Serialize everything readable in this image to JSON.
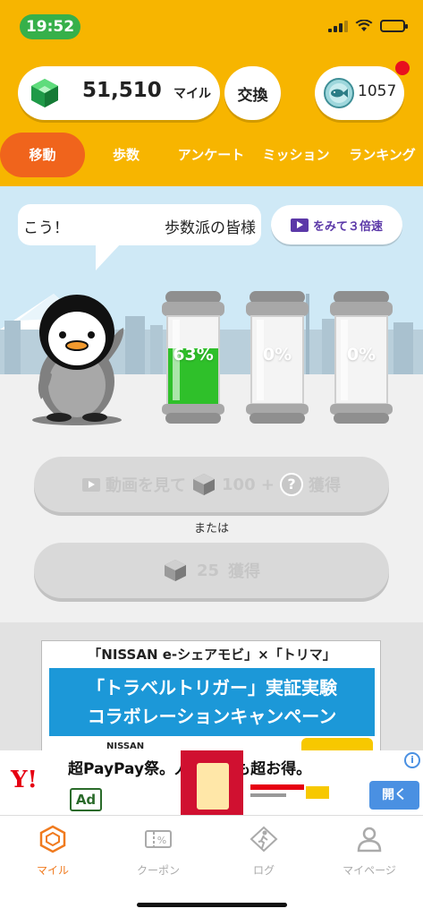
{
  "status_bar": {
    "time": "19:52"
  },
  "header": {
    "miles_value": "51,510",
    "miles_unit": "マイル",
    "exchange_label": "交換",
    "fish_count": "1057"
  },
  "tabs": [
    "移動",
    "歩数",
    "アンケート",
    "ミッション",
    "ランキング"
  ],
  "active_tab": "移動",
  "stage": {
    "bubble_text_left": "こう！",
    "bubble_text_right": "歩数派の皆様",
    "speed_button_label": "をみて３倍速",
    "capsules": [
      {
        "label": "63%",
        "fill": 0.63
      },
      {
        "label": "0%",
        "fill": 0
      },
      {
        "label": "0%",
        "fill": 0
      }
    ],
    "watch_video_label": "動画を見て",
    "watch_video_amount": "100 +",
    "watch_video_suffix": "獲得",
    "or_label": "または",
    "get_amount": "25",
    "get_suffix": "獲得"
  },
  "banner": {
    "title": "「NISSAN e-シェアモビ」×「トリマ」",
    "line1": "「トラベルトリガー」実証実験",
    "line2": "コラボレーションキャンペーン",
    "nissan": "NISSAN"
  },
  "ad": {
    "logo": "Y!",
    "title": "超PayPay祭。人気商品も超お得。",
    "badge": "Ad",
    "open_label": "開く",
    "info": "i"
  },
  "bottom_nav": [
    {
      "label": "マイル",
      "icon": "gem-outline-icon"
    },
    {
      "label": "クーポン",
      "icon": "coupon-icon"
    },
    {
      "label": "ログ",
      "icon": "walker-log-icon"
    },
    {
      "label": "マイページ",
      "icon": "person-icon"
    }
  ],
  "colors": {
    "header": "#f7b500",
    "active_tab": "#f0641c",
    "capsule_green": "#2fc02a",
    "accent_purple": "#5b38a8",
    "nav_active": "#f07a1e"
  }
}
